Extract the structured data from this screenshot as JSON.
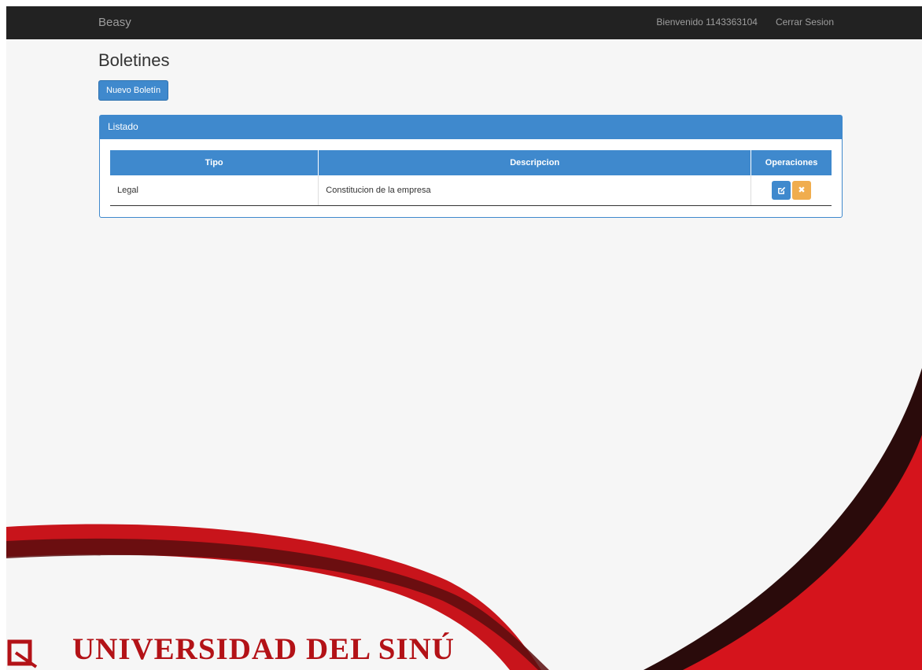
{
  "navbar": {
    "brand": "Beasy",
    "welcome": "Bienvenido 1143363104",
    "logout": "Cerrar Sesion"
  },
  "page": {
    "title": "Boletines",
    "new_button": "Nuevo Boletín"
  },
  "panel": {
    "heading": "Listado",
    "columns": [
      "Tipo",
      "Descripcion",
      "Operaciones"
    ],
    "rows": [
      {
        "tipo": "Legal",
        "descripcion": "Constitucion de la empresa"
      }
    ],
    "operations": {
      "edit_icon": "edit-icon",
      "delete_icon": "close-icon"
    }
  },
  "branding": {
    "logo_text": "UNIVERSIDAD DEL SINÚ"
  },
  "colors": {
    "navbar": "#222222",
    "primary": "#3f89cd",
    "warning": "#f0ad4e",
    "brand_red": "#b31217"
  }
}
